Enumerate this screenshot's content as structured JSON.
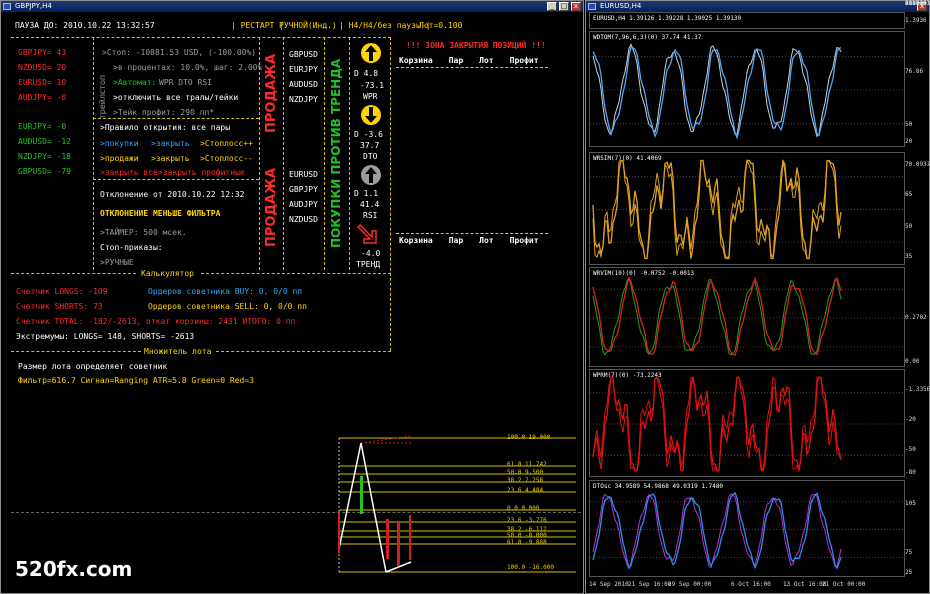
{
  "left_window": {
    "title": "GBPJPY,H4",
    "buttons": [
      "_",
      "□",
      "x"
    ]
  },
  "right_window": {
    "title": "EURUSD,H4",
    "buttons": [
      "x"
    ]
  },
  "header": {
    "pause": "ПАУЗА ДО: 2010.10.22 13:32:57",
    "restart": "| РЕСТАРТ |",
    "mode": "РУЧНОЙ(Инд.)",
    "tf": "| H4/H4/без паузы |",
    "lot": "Лот=0.100"
  },
  "pairs_left": [
    {
      "text": "GBPJPY= 43",
      "color": "#ff2a2a"
    },
    {
      "text": "NZDUSD= 20",
      "color": "#ff2a2a"
    },
    {
      "text": "EURUSD= 10",
      "color": "#ff2a2a"
    },
    {
      "text": "AUDJPY= -0",
      "color": "#ff2a2a"
    },
    {
      "text": "EURJPY= -0",
      "color": "#22c025"
    },
    {
      "text": "AUDUSD= -12",
      "color": "#22c025"
    },
    {
      "text": "NZDJPY= -18",
      "color": "#22c025"
    },
    {
      "text": "GBPUSD= -79",
      "color": "#22c025"
    }
  ],
  "trailing_label": "трейлстоп",
  "control": {
    "stop": ">Стоп: -10881.53 USD, (-100.00%)",
    "percent": ">в процентах: 10.0%, шаг: 2.00%",
    "auto_prefix": ">Автомат:",
    "auto_opts": "WPR  DTO  RSI",
    "disable_trails": ">отключить все тралы/тейки",
    "take_profit": ">Тейк профит: 290 пп*",
    "open_rule": ">Правило открытия: все пары",
    "buys": ">покупки",
    "close1": ">закрыть",
    "sl_plus": ">Стоплосс++",
    "sells": ">продажи",
    "close2": ">закрыть",
    "sl_minus": ">Стоплосс--",
    "close_all": ">закрыть все",
    "close_profit": ">закрыть профитные",
    "deviation": "Отклонение от 2010.10.22 12:32",
    "deviation_msg": "ОТКЛОНЕНИЕ МЕНЬШЕ ФИЛЬТРА",
    "timer": ">ТАЙМЕР: 500 мсек.",
    "stop_orders": "Стоп-приказы:",
    "manual": ">РУЧНЫЕ"
  },
  "sell_label_1": "ПРОДАЖА",
  "sell_label_2": "ПРОДАЖА",
  "counter_trend_label": "ПОКУПКИ ПРОТИВ ТРЕНДА",
  "sell_pairs_1": [
    "GBPUSD",
    "EURJPY",
    "AUDUSD",
    "NZDJPY"
  ],
  "sell_pairs_2": [
    "EURUSD",
    "GBPJPY",
    "AUDJPY",
    "NZDUSD"
  ],
  "signals": [
    {
      "d": "D",
      "v1": "4.8",
      "v2": "-73.1",
      "name": "WPR",
      "dir": "up",
      "color": "#ffd400"
    },
    {
      "d": "D",
      "v1": "-3.6",
      "v2": "37.7",
      "name": "DTO",
      "dir": "down",
      "color": "#ffd400"
    },
    {
      "d": "D",
      "v1": "1.1",
      "v2": "41.4",
      "name": "RSI",
      "dir": "up",
      "color": "#9c9c9c"
    },
    {
      "d": "",
      "v1": "",
      "v2": "-4.0",
      "name": "ТРЕНД",
      "dir": "down-right",
      "color": "#ff2a2a"
    }
  ],
  "zone_title": "!!! ЗОНА ЗАКРЫТИЯ ПОЗИЦИЙ !!!",
  "table_headers": [
    "Корзина",
    "Пар",
    "Лот",
    "Профит"
  ],
  "calculator_label": "Калькулятор",
  "multiplier_label": "Множитель лота",
  "counters": {
    "longs": "Счетчик  LONGS:  -109",
    "shorts": "Счетчик  SHORTS:  73",
    "total": "Счетчик  TOTAL:  -182/-2613, откат корзины: 2431 ИТОГО: 0 пп",
    "buy_orders": "Ордеров советника  BUY: 0, 0/0 пп",
    "sell_orders": "Ордеров советника SELL: 0, 0/0 пп",
    "extremes": "Экстремумы: LONGS= 148, SHORTS= -2613"
  },
  "lot_info": "Размер лота определяет советник",
  "filter_info": "Фильтр=616.7 Сигнал=Ranging ATR=5.8 Green=0 Red=3",
  "fib_levels": [
    "100.0  19.000",
    "61.8  11.742",
    "50.0  9.500",
    "38.2  7.258",
    "23.6  4.484",
    "0.0  0.000",
    "23.6  -3.776",
    "38.2  -6.112",
    "50.0  -8.000",
    "61.8  -9.888",
    "100.0  -16.000"
  ],
  "panels": [
    {
      "label": "EURUSD,H4  1.39126  1.39228  1.39025  1.39130",
      "axis": [
        "1.3936",
        "1.2930"
      ],
      "color": "#4aa8ff",
      "color2": "#cfcfcf"
    },
    {
      "label": "WDTOM(7,96,6,3)(0)  37.74  41.37",
      "axis": [
        "76.86",
        "50",
        "20",
        "8.44"
      ],
      "color": "#4aa8ff",
      "color2": "#cfcfcf"
    },
    {
      "label": "WRSIM(7)(0)  41.4069",
      "axis": [
        "70.0937",
        "65",
        "50",
        "35",
        "18.744"
      ],
      "color": "#e0a020",
      "color2": "#e0a020"
    },
    {
      "label": "WRVIM(10)(0)  -0.0752  -0.0013",
      "axis": [
        "0.2702",
        "0.00",
        "-0.2293"
      ],
      "color": "#e02020",
      "color2": "#20a020"
    },
    {
      "label": "WPRM(7)(0)  -73.2243",
      "axis": [
        "-1.3356",
        "-20",
        "-50",
        "-80",
        "-101.614"
      ],
      "color": "#e01010",
      "color2": "#e01010"
    },
    {
      "label": "DTOsc  34.9589  54.9868  49.0319  1.7480",
      "axis": [
        "105",
        "75",
        "25",
        "0.00"
      ],
      "color": "#2090ff",
      "color2": "#c030c0"
    }
  ],
  "time_axis": [
    "14 Sep 2010",
    "21 Sep 16:00",
    "29 Sep 00:00",
    "6 Oct 16:00",
    "13 Oct 16:00",
    "21 Oct 00:00"
  ],
  "watermark": "520fx.com"
}
